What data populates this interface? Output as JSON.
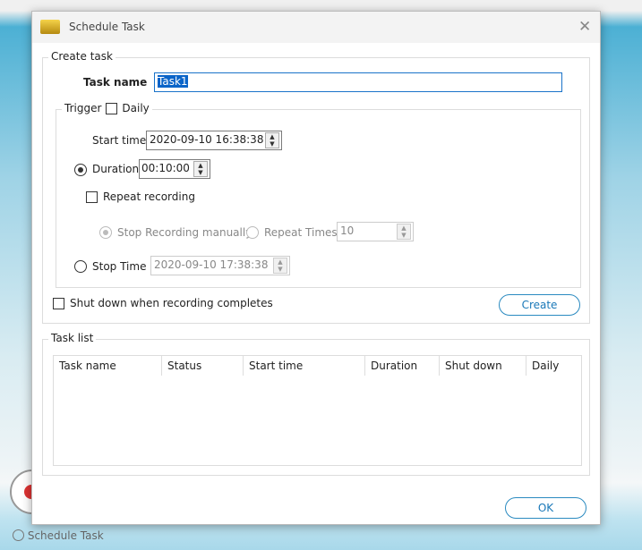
{
  "background": {
    "status_label": "Schedule Task"
  },
  "dialog": {
    "title": "Schedule Task",
    "close_icon": "close-icon",
    "create_task": {
      "legend": "Create task",
      "task_name_label": "Task name",
      "task_name_value": "Task1",
      "trigger_label": "Trigger",
      "daily_label": "Daily",
      "daily_checked": false,
      "start_time_label": "Start time",
      "start_time_value": "2020-09-10 16:38:38",
      "duration_label": "Duration",
      "duration_value": "00:10:00",
      "duration_selected": true,
      "repeat_recording_label": "Repeat recording",
      "repeat_recording_checked": false,
      "stop_manually_label": "Stop Recording manually",
      "repeat_times_label": "Repeat Times",
      "repeat_times_value": "10",
      "stop_time_label": "Stop Time",
      "stop_time_value": "2020-09-10 17:38:38",
      "shutdown_label": "Shut down when recording completes",
      "create_button": "Create"
    },
    "task_list": {
      "legend": "Task list",
      "columns": [
        "Task name",
        "Status",
        "Start time",
        "Duration",
        "Shut down",
        "Daily"
      ],
      "rows": []
    },
    "ok_button": "OK"
  }
}
